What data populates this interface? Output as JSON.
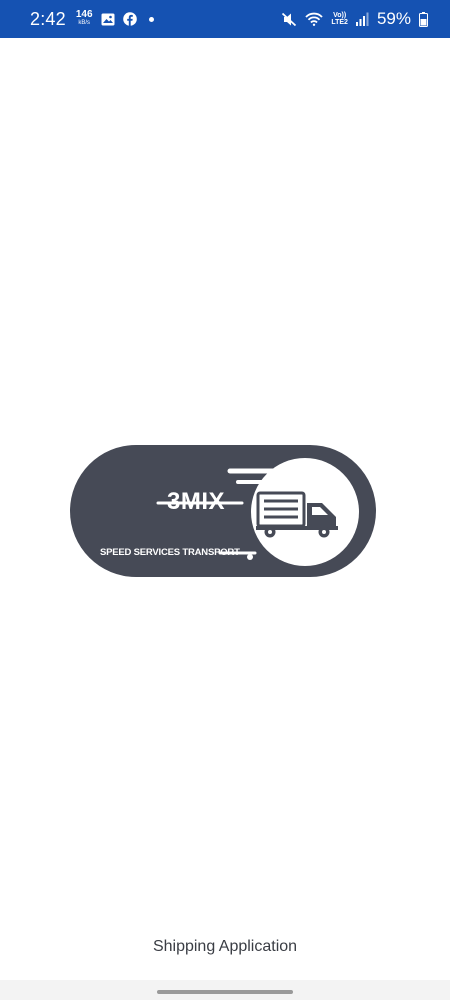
{
  "status_bar": {
    "time": "2:42",
    "net_speed_value": "146",
    "net_speed_unit": "kB/s",
    "volte_top": "Vo))",
    "volte_bottom": "LTE2",
    "battery": "59%",
    "background_color": "#1552b2",
    "icons": [
      "gallery-icon",
      "facebook-icon",
      "mute-icon",
      "wifi-icon",
      "signal-icon",
      "battery-icon"
    ]
  },
  "logo": {
    "brand": "3MIX",
    "tagline": "SPEED SERVICES TRANSPORT",
    "color": "#464a56"
  },
  "app": {
    "name": "Shipping Application"
  }
}
